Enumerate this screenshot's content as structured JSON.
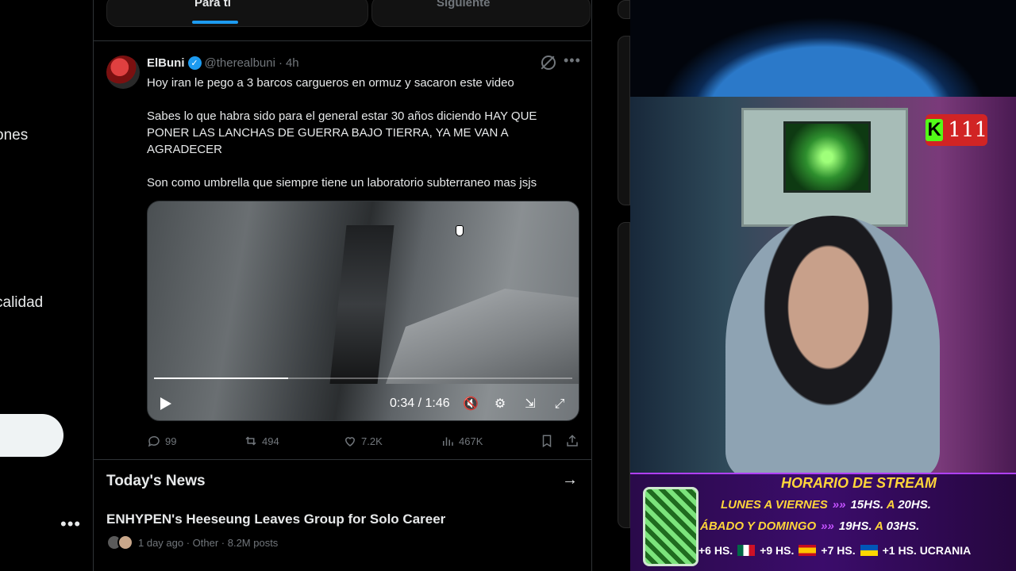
{
  "sidebar": {
    "partial_labels": [
      "ones",
      "calidad"
    ],
    "more_label": "•••"
  },
  "tabs": [
    {
      "label": "Para ti",
      "active": true
    },
    {
      "label": "Siguiente",
      "active": false
    }
  ],
  "tweet": {
    "name": "ElBuni",
    "handle": "@therealbuni",
    "separator": "·",
    "time": "4h",
    "more": "•••",
    "paragraphs": [
      "Hoy iran le pego a 3 barcos cargueros en ormuz y sacaron este video",
      "Sabes lo que habra sido para el general estar 30 años diciendo HAY QUE PONER LAS LANCHAS DE GUERRA BAJO TIERRA, YA ME VAN A AGRADECER",
      "Son como umbrella que siempre tiene un laboratorio subterraneo mas jsjs"
    ],
    "video": {
      "time_display": "0:34 / 1:46",
      "progress": 0.32
    },
    "stats": {
      "replies": "99",
      "reposts": "494",
      "likes": "7.2K",
      "views": "467K"
    }
  },
  "news": {
    "title": "Today's News",
    "headline": "ENHYPEN's Heeseung Leaves Group for Solo Career",
    "meta": "1 day ago · Other · 8.2M posts"
  },
  "stream": {
    "viewer_count": "111",
    "schedule_title": "HORARIO DE STREAM",
    "rows": [
      {
        "days": "LUNES A VIERNES",
        "from": "15HS.",
        "sep": "A",
        "to": "20HS."
      },
      {
        "days": "ÁBADO Y DOMINGO",
        "from": "19HS.",
        "sep": "A",
        "to": "03HS."
      }
    ],
    "timezones": [
      "+6 HS.",
      "+9 HS.",
      "+7 HS.",
      "+1 HS. UCRANIA"
    ]
  },
  "colors": {
    "accent": "#1d9bf0",
    "kick_green": "#53fc18",
    "schedule_yellow": "#ffd53a"
  }
}
